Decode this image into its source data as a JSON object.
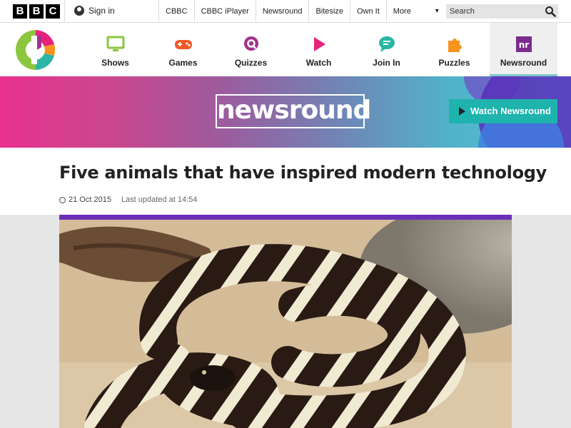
{
  "bbc": {
    "logo_letters": [
      "B",
      "B",
      "C"
    ],
    "sign_in": "Sign in",
    "nav": [
      "CBBC",
      "CBBC iPlayer",
      "Newsround",
      "Bitesize",
      "Own It",
      "More"
    ],
    "search_placeholder": "Search"
  },
  "cbbc_nav": {
    "items": [
      {
        "label": "Shows",
        "icon": "tv-icon",
        "color": "#8cc63f"
      },
      {
        "label": "Games",
        "icon": "gamepad-icon",
        "color": "#f05a28"
      },
      {
        "label": "Quizzes",
        "icon": "quiz-icon",
        "color": "#a3308f"
      },
      {
        "label": "Watch",
        "icon": "play-icon",
        "color": "#e5237a"
      },
      {
        "label": "Join In",
        "icon": "chat-icon",
        "color": "#2ab5a5"
      },
      {
        "label": "Puzzles",
        "icon": "puzzle-icon",
        "color": "#f7941d"
      },
      {
        "label": "Newsround",
        "icon": "newsround-icon",
        "color": "#7b2d8e",
        "active": true
      }
    ]
  },
  "banner": {
    "logo_text": "newsround",
    "watch_button": "Watch Newsround"
  },
  "article": {
    "title": "Five animals that have inspired modern technology",
    "date": "21 Oct 2015",
    "last_updated": "Last updated at 14:54"
  },
  "colors": {
    "accent_purple": "#6b2fb8",
    "watch_teal": "#1fb3ad"
  }
}
